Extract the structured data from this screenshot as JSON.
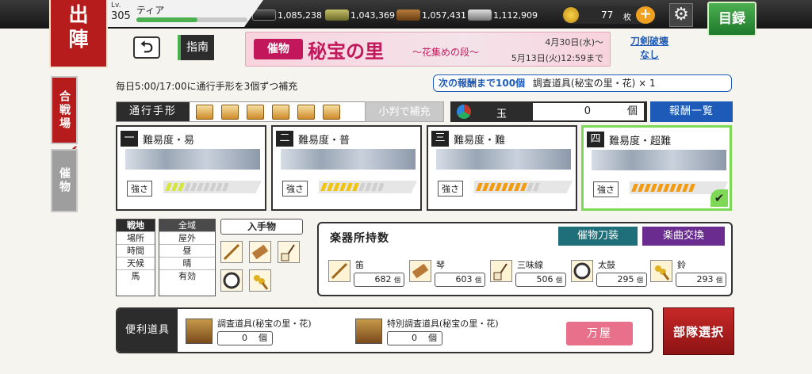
{
  "header": {
    "mode_title": [
      "出",
      "陣"
    ],
    "level_label": "Lv.",
    "level": "305",
    "player_name": "ティア",
    "exp_ratio": 0.55,
    "resources": [
      "1,085,238",
      "1,043,369",
      "1,057,431",
      "1,112,909"
    ],
    "coins": "77",
    "coin_unit": "枚",
    "coin_plus": "+",
    "settings_icon": "gear-icon",
    "catalog_label": "目録"
  },
  "side_tabs": {
    "battlefield": "合戦場",
    "treasure": "催物"
  },
  "toolbar": {
    "back_icon": "back-arrow-icon",
    "back_glyph": "⮌",
    "guide_label": "指南"
  },
  "banner": {
    "tag": "催物",
    "title": "秘宝の里",
    "subtitle": "～花集めの段～",
    "date_start": "4月30日(水)～",
    "date_end": "5月13日(火)12:59まで"
  },
  "sword_break": [
    "刀剣破壊",
    "なし"
  ],
  "daily_note": "毎日5:00/17:00に通行手形を3個ずつ補充",
  "next_reward": {
    "prefix": "次の報酬まで100個",
    "item": "調査道具(秘宝の里・花) × 1"
  },
  "pass": {
    "label": "通行手形",
    "count": 6,
    "koban_button": "小判で補充"
  },
  "tama": {
    "label": "玉",
    "value": "0",
    "unit": "個"
  },
  "reward_list_button": "報酬一覧",
  "difficulties": [
    {
      "num": "一",
      "label": "難易度・易",
      "strength_label": "強さ",
      "strength_filled": 3,
      "strength_max": 10,
      "color": "#d6e63c"
    },
    {
      "num": "二",
      "label": "難易度・普",
      "strength_label": "強さ",
      "strength_filled": 6,
      "strength_max": 10,
      "color": "#f1c40f"
    },
    {
      "num": "三",
      "label": "難易度・難",
      "strength_label": "強さ",
      "strength_filled": 8,
      "strength_max": 10,
      "color": "#f39c12"
    },
    {
      "num": "四",
      "label": "難易度・超難",
      "strength_label": "強さ",
      "strength_filled": 10,
      "strength_max": 10,
      "color": "#f39c12",
      "selected": true
    }
  ],
  "conditions": {
    "headers": [
      "戦地",
      "場所",
      "時間",
      "天候",
      "馬"
    ],
    "values": [
      "全域",
      "屋外",
      "昼",
      "晴",
      "有効"
    ]
  },
  "obtainable": {
    "label": "入手物",
    "icons": [
      "flute-icon",
      "koto-icon",
      "shamisen-icon",
      "drum-icon",
      "bell-icon"
    ]
  },
  "instruments": {
    "title": "楽器所持数",
    "treasure_sword_button": "催物刀装",
    "music_exchange_button": "楽曲交換",
    "unit": "個",
    "items": [
      {
        "name": "笛",
        "count": "682",
        "icon": "flute-icon"
      },
      {
        "name": "琴",
        "count": "603",
        "icon": "koto-icon"
      },
      {
        "name": "三味線",
        "count": "506",
        "icon": "shamisen-icon"
      },
      {
        "name": "太鼓",
        "count": "295",
        "icon": "drum-icon"
      },
      {
        "name": "鈴",
        "count": "293",
        "icon": "bell-icon"
      }
    ]
  },
  "convenience": {
    "label": "便利道具",
    "items": [
      {
        "name": "調査道具(秘宝の里・花)",
        "count": "0",
        "unit": "個"
      },
      {
        "name": "特別調査道具(秘宝の里・花)",
        "count": "0",
        "unit": "個"
      }
    ],
    "shop_button": "万屋"
  },
  "squad_select_button": "部隊選択"
}
